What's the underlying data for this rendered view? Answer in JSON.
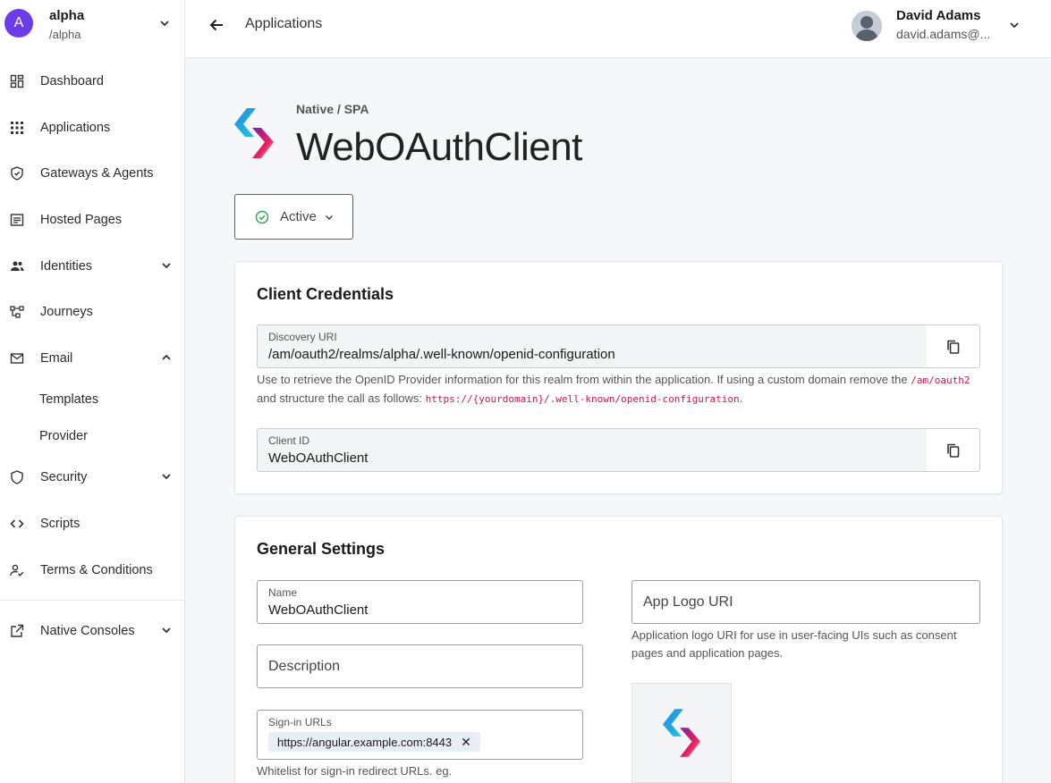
{
  "sidebar": {
    "realm": {
      "initial": "A",
      "name": "alpha",
      "path": "/alpha"
    },
    "items": [
      {
        "label": "Dashboard"
      },
      {
        "label": "Applications"
      },
      {
        "label": "Gateways & Agents"
      },
      {
        "label": "Hosted Pages"
      },
      {
        "label": "Identities"
      },
      {
        "label": "Journeys"
      },
      {
        "label": "Email"
      },
      {
        "label": "Templates"
      },
      {
        "label": "Provider"
      },
      {
        "label": "Security"
      },
      {
        "label": "Scripts"
      },
      {
        "label": "Terms & Conditions"
      },
      {
        "label": "Native Consoles"
      }
    ]
  },
  "header": {
    "breadcrumb": "Applications",
    "user_name": "David Adams",
    "user_email": "david.adams@..."
  },
  "app": {
    "type": "Native / SPA",
    "name": "WebOAuthClient",
    "status": "Active"
  },
  "credentials": {
    "title": "Client Credentials",
    "discovery_label": "Discovery URI",
    "discovery_value": "/am/oauth2/realms/alpha/.well-known/openid-configuration",
    "discovery_help_1": "Use to retrieve the OpenID Provider information for this realm from within the application. If using a custom domain remove the",
    "discovery_help_code1": "/am/oauth2",
    "discovery_help_2": "and structure the call as follows:",
    "discovery_help_code2": "https://{yourdomain}/.well-known/openid-configuration",
    "discovery_help_3": ".",
    "client_id_label": "Client ID",
    "client_id_value": "WebOAuthClient"
  },
  "general": {
    "title": "General Settings",
    "name_label": "Name",
    "name_value": "WebOAuthClient",
    "description_placeholder": "Description",
    "signin_label": "Sign-in URLs",
    "signin_chip": "https://angular.example.com:8443",
    "signin_help": "Whitelist for sign-in redirect URLs. eg.",
    "logo_uri_placeholder": "App Logo URI",
    "logo_uri_help": "Application logo URI for use in user-facing UIs such as consent pages and application pages."
  },
  "colors": {
    "accent": "#6c3ce9",
    "status_ok": "#2fa84f",
    "code": "#c2185b"
  }
}
